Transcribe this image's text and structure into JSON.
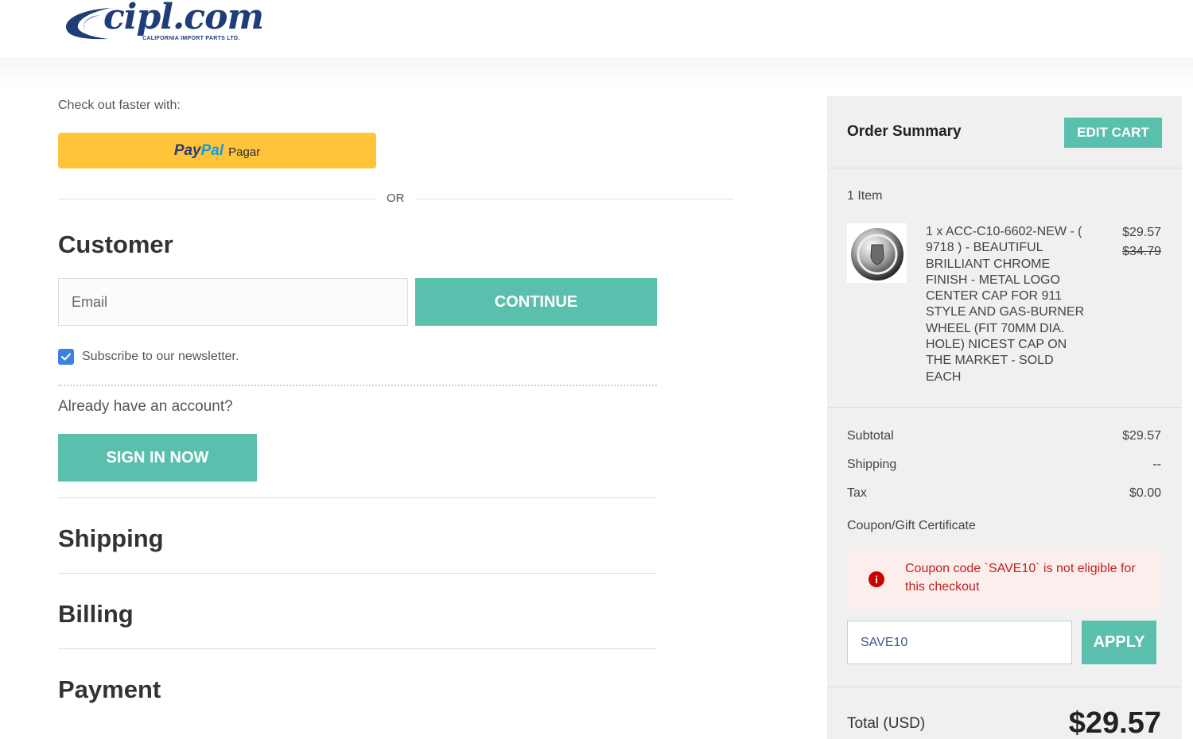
{
  "header": {
    "logo_text": "cipl.com",
    "logo_subtext": "CALIFORNIA IMPORT PARTS LTD."
  },
  "checkout": {
    "faster_label": "Check out faster with:",
    "paypal": {
      "pay": "Pay",
      "pal": "Pal",
      "label": "Pagar"
    },
    "or_text": "OR",
    "customer_title": "Customer",
    "email_placeholder": "Email",
    "continue_label": "CONTINUE",
    "newsletter_label": "Subscribe to our newsletter.",
    "newsletter_checked": true,
    "account_question": "Already have an account?",
    "signin_label": "SIGN IN NOW",
    "shipping_title": "Shipping",
    "billing_title": "Billing",
    "payment_title": "Payment"
  },
  "summary": {
    "title": "Order Summary",
    "edit_cart_label": "EDIT CART",
    "item_count": "1 Item",
    "item": {
      "description": "1 x ACC-C10-6602-NEW - ( 9718 ) - BEAUTIFUL BRILLIANT CHROME FINISH - METAL LOGO CENTER CAP FOR 911 STYLE AND GAS-BURNER WHEEL (FIT 70MM DIA. HOLE) NICEST CAP ON THE MARKET - SOLD EACH",
      "price": "$29.57",
      "original_price": "$34.79"
    },
    "subtotal_label": "Subtotal",
    "subtotal_value": "$29.57",
    "shipping_label": "Shipping",
    "shipping_value": "--",
    "tax_label": "Tax",
    "tax_value": "$0.00",
    "coupon_label": "Coupon/Gift Certificate",
    "coupon_error": "Coupon code `SAVE10` is not eligible for this checkout",
    "coupon_value": "SAVE10",
    "apply_label": "APPLY",
    "total_label": "Total (USD)",
    "total_value": "$29.57"
  },
  "colors": {
    "accent": "#5bbfad",
    "paypal_yellow": "#ffc439",
    "error_text": "#c0231c",
    "error_bg": "#fdeeee",
    "checkbox": "#3b82e0"
  }
}
